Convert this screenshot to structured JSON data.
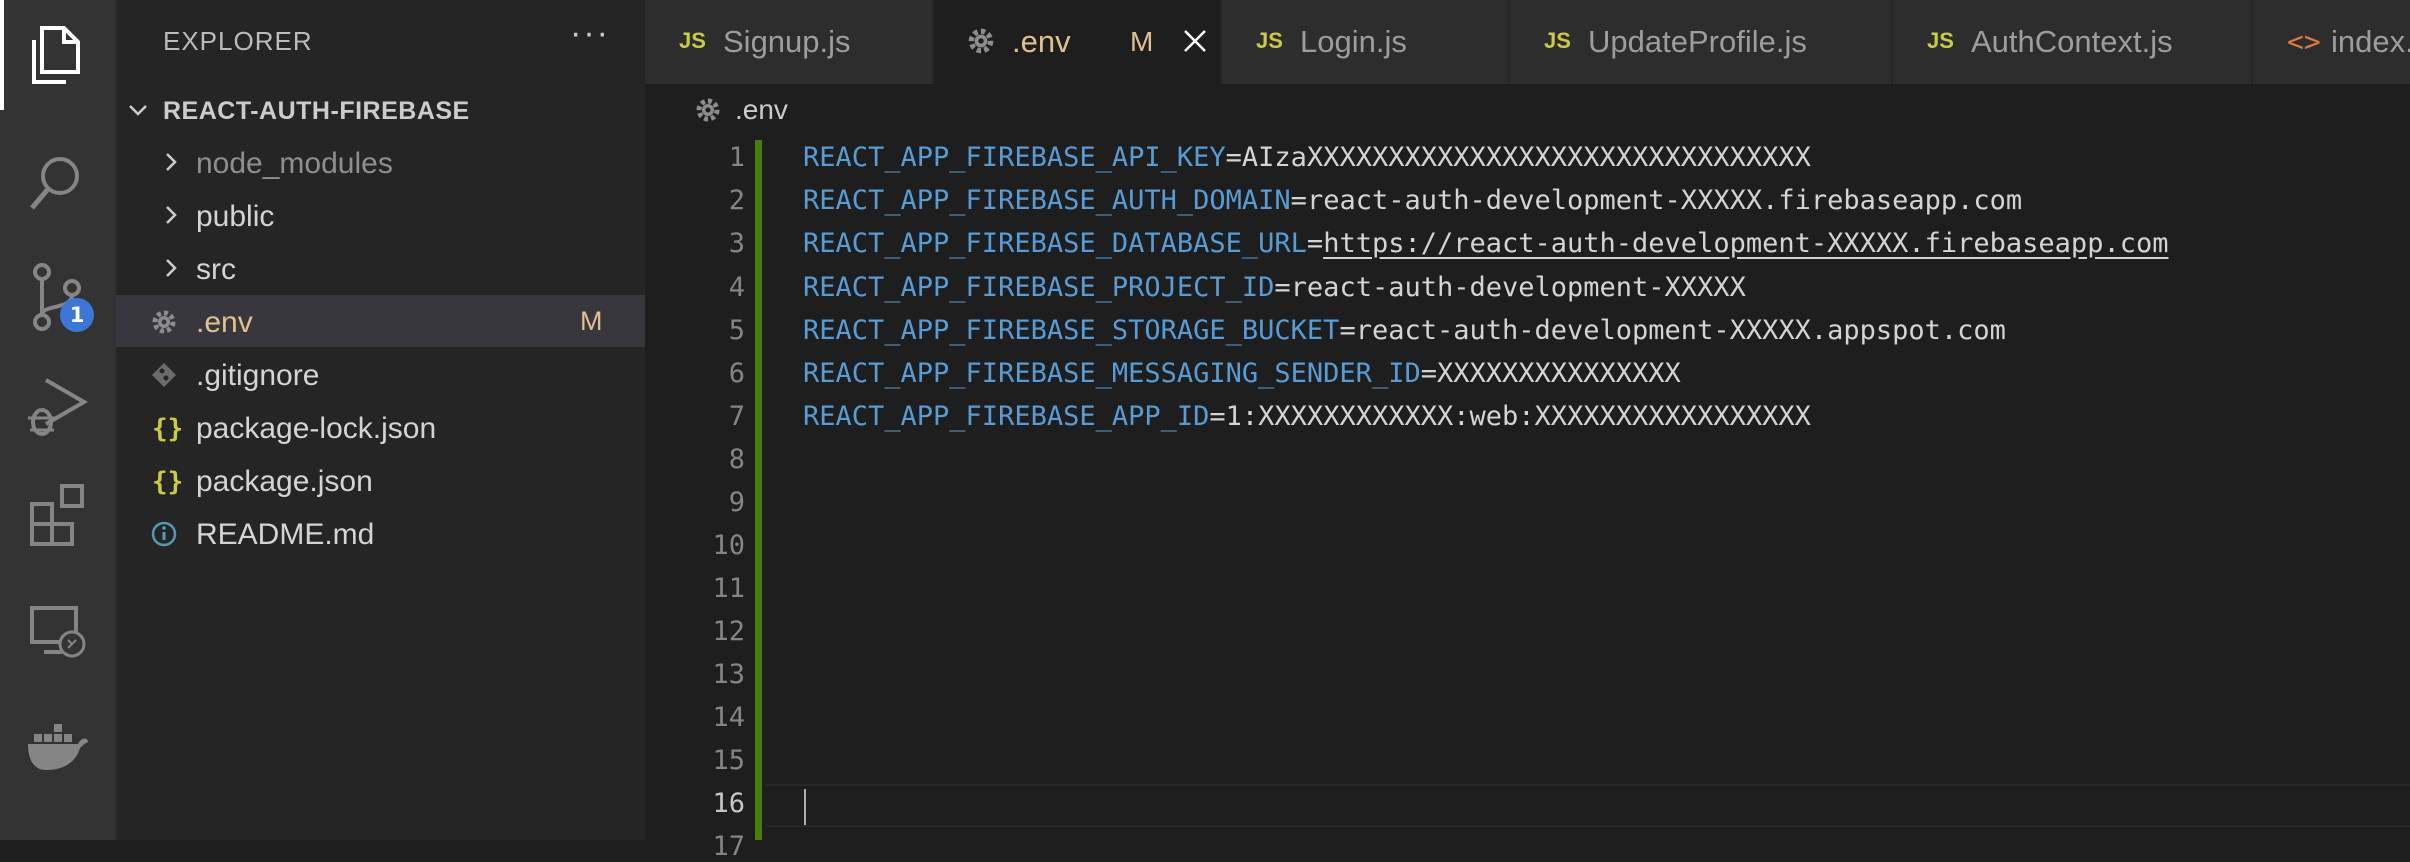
{
  "activity_bar": {
    "items": [
      {
        "icon": "files-icon"
      },
      {
        "icon": "search-icon"
      },
      {
        "icon": "source-control-icon",
        "badge": "1"
      },
      {
        "icon": "run-debug-icon"
      },
      {
        "icon": "extensions-icon"
      },
      {
        "icon": "remote-explorer-icon"
      },
      {
        "icon": "docker-icon"
      }
    ]
  },
  "sidebar": {
    "title": "EXPLORER",
    "more_label": "···",
    "project": "REACT-AUTH-FIREBASE",
    "items": [
      {
        "label": "node_modules",
        "type": "folder"
      },
      {
        "label": "public",
        "type": "folder"
      },
      {
        "label": "src",
        "type": "folder"
      },
      {
        "label": ".env",
        "type": "settings",
        "status": "M"
      },
      {
        "label": ".gitignore",
        "type": "git"
      },
      {
        "label": "package-lock.json",
        "type": "json"
      },
      {
        "label": "package.json",
        "type": "json"
      },
      {
        "label": "README.md",
        "type": "info"
      }
    ]
  },
  "tabs": [
    {
      "label": "Signup.js",
      "icon": "JS"
    },
    {
      "label": ".env",
      "icon": "gear",
      "status": "M",
      "active": true
    },
    {
      "label": "Login.js",
      "icon": "JS"
    },
    {
      "label": "UpdateProfile.js",
      "icon": "JS"
    },
    {
      "label": "AuthContext.js",
      "icon": "JS"
    },
    {
      "label": "index.",
      "icon": "<>"
    }
  ],
  "breadcrumb": {
    "file": ".env"
  },
  "editor": {
    "line_numbers": [
      "1",
      "2",
      "3",
      "4",
      "5",
      "6",
      "7",
      "8",
      "9",
      "10",
      "11",
      "12",
      "13",
      "14",
      "15",
      "16",
      "17"
    ],
    "lines": [
      {
        "key": "REACT_APP_FIREBASE_API_KEY",
        "eq": "=",
        "value": "AIzaXXXXXXXXXXXXXXXXXXXXXXXXXXXXXXX"
      },
      {
        "key": "REACT_APP_FIREBASE_AUTH_DOMAIN",
        "eq": "=",
        "value": "react-auth-development-XXXXX.firebaseapp.com"
      },
      {
        "key": "REACT_APP_FIREBASE_DATABASE_URL",
        "eq": "=",
        "value": "https://react-auth-development-XXXXX.firebaseapp.com"
      },
      {
        "key": "REACT_APP_FIREBASE_PROJECT_ID",
        "eq": "=",
        "value": "react-auth-development-XXXXX"
      },
      {
        "key": "REACT_APP_FIREBASE_STORAGE_BUCKET",
        "eq": "=",
        "value": "react-auth-development-XXXXX.appspot.com"
      },
      {
        "key": "REACT_APP_FIREBASE_MESSAGING_SENDER_ID",
        "eq": "=",
        "value": "XXXXXXXXXXXXXXX"
      },
      {
        "key": "REACT_APP_FIREBASE_APP_ID",
        "eq": "=",
        "value": "1:XXXXXXXXXXXX:web:XXXXXXXXXXXXXXXXX"
      }
    ],
    "current_line": "16"
  },
  "colors": {
    "env_key": "#569cd6",
    "modified": "#e2c08d",
    "js_icon": "#cbcb41",
    "diff_added": "#487e02",
    "badge": "#3a77d8"
  }
}
